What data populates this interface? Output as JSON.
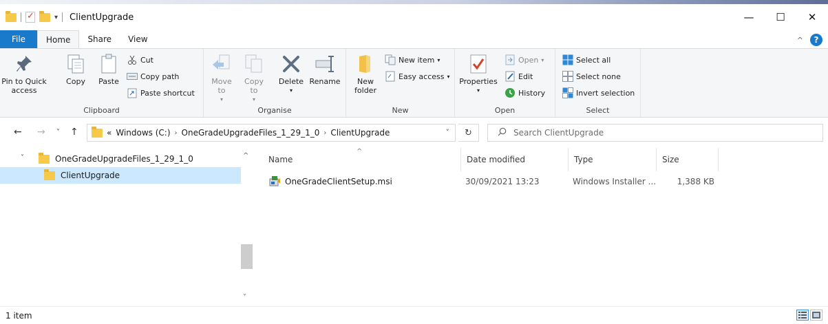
{
  "window": {
    "title": "ClientUpgrade"
  },
  "ribbon_tabs": [
    "File",
    "Home",
    "Share",
    "View"
  ],
  "ribbon": {
    "clipboard": {
      "group": "Clipboard",
      "pin": "Pin to Quick access",
      "copy": "Copy",
      "paste": "Paste",
      "cut": "Cut",
      "copy_path": "Copy path",
      "paste_shortcut": "Paste shortcut"
    },
    "organise": {
      "group": "Organise",
      "move_to": "Move to",
      "copy_to": "Copy to",
      "delete": "Delete",
      "rename": "Rename"
    },
    "new": {
      "group": "New",
      "new_folder": "New folder",
      "new_item": "New item",
      "easy_access": "Easy access"
    },
    "open": {
      "group": "Open",
      "properties": "Properties",
      "open": "Open",
      "edit": "Edit",
      "history": "History"
    },
    "select": {
      "group": "Select",
      "select_all": "Select all",
      "select_none": "Select none",
      "invert": "Invert selection"
    }
  },
  "address": {
    "overflow": "«",
    "crumbs": [
      "Windows (C:)",
      "OneGradeUpgradeFiles_1_29_1_0",
      "ClientUpgrade"
    ],
    "search_placeholder": "Search ClientUpgrade"
  },
  "nav_tree": [
    {
      "label": "OneGradeUpgradeFiles_1_29_1_0",
      "expanded": true,
      "selected": false
    },
    {
      "label": "ClientUpgrade",
      "expanded": false,
      "selected": true
    }
  ],
  "columns": [
    "Name",
    "Date modified",
    "Type",
    "Size"
  ],
  "files": [
    {
      "name": "OneGradeClientSetup.msi",
      "date": "30/09/2021 13:23",
      "type": "Windows Installer ...",
      "size": "1,388 KB"
    }
  ],
  "status": {
    "count": "1 item"
  },
  "colors": {
    "accent": "#1979ca",
    "selection": "#cce8ff",
    "folder": "#f7c948",
    "ribbon_bg": "#f5f6f7"
  }
}
